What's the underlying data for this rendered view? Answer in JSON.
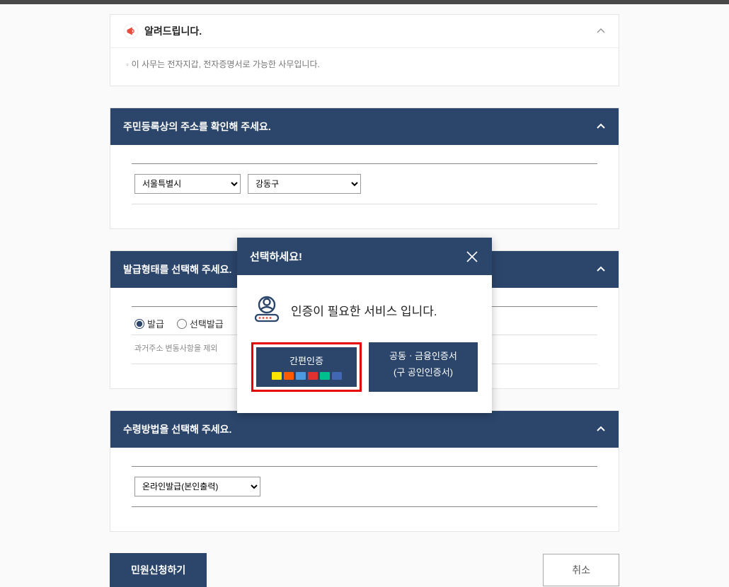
{
  "notice": {
    "title": "알려드립니다.",
    "body": "이 사무는 전자지갑, 전자증명서로 가능한 사무입니다."
  },
  "addressSection": {
    "title": "주민등록상의 주소를 확인해 주세요.",
    "city": "서울특별시",
    "district": "강동구"
  },
  "issueSection": {
    "title": "발급형태를 선택해 주세요.",
    "radio1": "발급",
    "radio2": "선택발급",
    "sub": "과거주소 변동사항을 제외"
  },
  "methodSection": {
    "title": "수령방법을 선택해 주세요.",
    "method": "온라인발급(본인출력)"
  },
  "actions": {
    "submit": "민원신청하기",
    "cancel": "취소"
  },
  "modal": {
    "header": "선택하세요!",
    "message": "인증이 필요한 서비스 입니다.",
    "btnSimple": "간편인증",
    "btnCert1": "공동ㆍ금융인증서",
    "btnCert2": "(구 공인인증서)"
  }
}
